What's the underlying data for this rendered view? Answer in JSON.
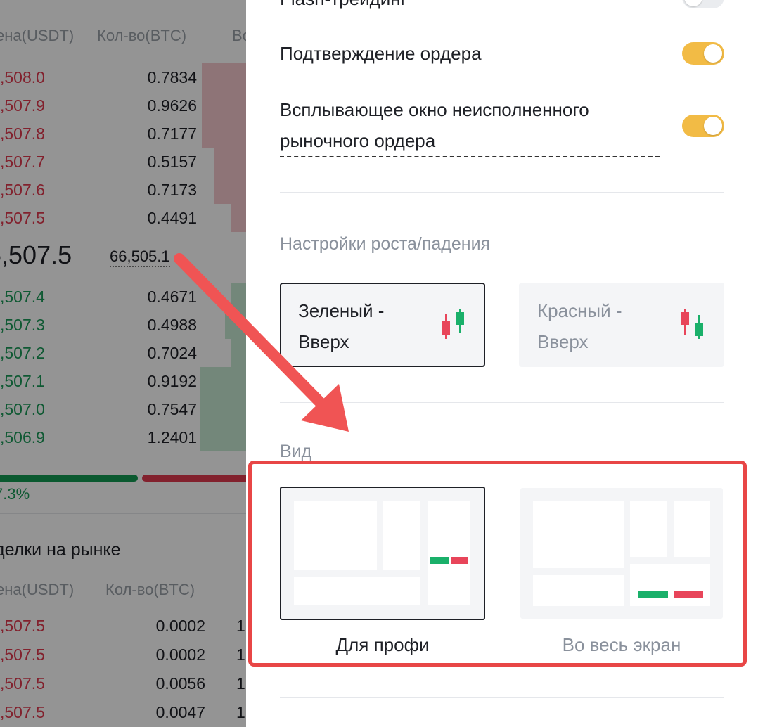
{
  "order_book": {
    "header_price": "ена(USDT)",
    "header_qty": "Кол-во(BTC)",
    "header_total": "Во",
    "asks": [
      {
        "price": ",508.0",
        "qty": "0.7834",
        "depth": 0.42
      },
      {
        "price": ",507.9",
        "qty": "0.9626",
        "depth": 0.42
      },
      {
        "price": ",507.8",
        "qty": "0.7177",
        "depth": 0.42
      },
      {
        "price": ",507.7",
        "qty": "0.5157",
        "depth": 0.3
      },
      {
        "price": ",507.6",
        "qty": "0.7173",
        "depth": 0.3
      },
      {
        "price": ",507.5",
        "qty": "0.4491",
        "depth": 0.14
      }
    ],
    "last_price": "6,507.5",
    "mark_price": "66,505.1",
    "bids": [
      {
        "price": ",507.4",
        "qty": "0.4671",
        "depth": 0.14
      },
      {
        "price": ",507.3",
        "qty": "0.4988",
        "depth": 0.2
      },
      {
        "price": ",507.2",
        "qty": "0.7024",
        "depth": 0.14
      },
      {
        "price": ",507.1",
        "qty": "0.9192",
        "depth": 0.44
      },
      {
        "price": ",507.0",
        "qty": "0.7547",
        "depth": 0.44
      },
      {
        "price": ",506.9",
        "qty": "1.2401",
        "depth": 0.44
      }
    ],
    "buy_ratio": "7.3%"
  },
  "market_trades": {
    "title": "делки на рынке",
    "header_price": "ена(USDT)",
    "header_qty": "Кол-во(BTC)",
    "rows": [
      {
        "price": ",507.5",
        "qty": "0.0002",
        "time": "1"
      },
      {
        "price": ",507.5",
        "qty": "0.0002",
        "time": "1"
      },
      {
        "price": ",507.5",
        "qty": "0.0056",
        "time": "1"
      },
      {
        "price": ",507.5",
        "qty": "0.0047",
        "time": "1"
      }
    ]
  },
  "settings": {
    "flash_trading_label": "Flash-трейдинг",
    "order_confirm_label": "Подтверждение ордера",
    "popup_label": "Всплывающее окно неисполненного рыночного ордера",
    "popup_line1": "Всплывающее окно неисполненного",
    "popup_line2": "рыночного ордера",
    "flash_on": false,
    "order_confirm_on": true,
    "popup_on": true,
    "color_section_title": "Настройки роста/падения",
    "color_options": [
      {
        "label": "Зеленый -\nВверх",
        "selected": true
      },
      {
        "label": "Красный -\nВверх",
        "selected": false
      }
    ],
    "view_section_title": "Вид",
    "view_options": [
      {
        "label": "Для профи",
        "selected": true
      },
      {
        "label": "Во весь экран",
        "selected": false
      }
    ]
  },
  "colors": {
    "up_green": "#1ab06a",
    "down_red": "#e8455a",
    "toggle_on": "#f2bb45",
    "highlight": "#e84646",
    "arrow": "#f05454"
  }
}
